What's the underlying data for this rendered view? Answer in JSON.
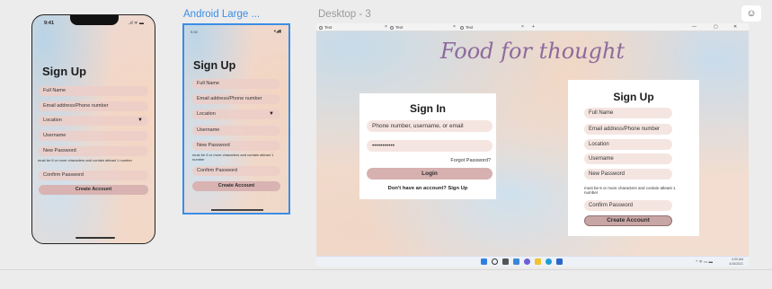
{
  "canvas": {
    "corner_icon": "comment-icon"
  },
  "iphone": {
    "time": "9:41",
    "status": "..ıl ᯤ ▬",
    "title": "Sign Up",
    "fields": {
      "full_name": "Full Name",
      "email": "Email address/Phone number",
      "location": "Location",
      "location_caret": "▼",
      "username": "Username",
      "password": "New Password",
      "confirm": "Confirm Password"
    },
    "hint": "must be 6 or more characters and contain atleast 1 number",
    "button": "Create Account"
  },
  "android": {
    "frame_label": "Android Large ...",
    "time": "9:30",
    "status": "▾◢▮",
    "title": "Sign Up",
    "fields": {
      "full_name": "Full Name",
      "email": "Email address/Phone number",
      "location": "Location",
      "location_caret": "▼",
      "username": "Username",
      "password": "New Password",
      "confirm": "Confirm Password"
    },
    "hint": "must be 6 or more characters and contain atleast 1 number",
    "button": "Create Account"
  },
  "desktop": {
    "frame_label": "Desktop - 3",
    "tabs": [
      "Text",
      "Text",
      "Text"
    ],
    "tab_close": "×",
    "tab_add": "+",
    "window_controls": [
      "—",
      "▢",
      "✕"
    ],
    "headline": "Food for thought",
    "signin": {
      "title": "Sign In",
      "username_placeholder": "Phone number, username, or email",
      "password_value": "•••••••••••",
      "forgot": "Forgot Password?",
      "button": "Login",
      "footer": "Don't have an account? Sign Up"
    },
    "signup": {
      "title": "Sign Up",
      "full_name": "Full Name",
      "email": "Email address/Phone number",
      "location": "Location",
      "username": "Username",
      "password": "New Password",
      "hint": "must be 6 or more characters and contain atleast 1 number",
      "confirm": "Confirm Password",
      "button": "Create Account"
    },
    "taskbar": {
      "tray": "^ ᯤ ▭ ▬",
      "clock_time": "4:00 AM",
      "clock_date": "4/15/2021",
      "icons": [
        "windows-icon",
        "search-icon",
        "file-explorer-icon",
        "widgets-icon",
        "chat-icon",
        "folder-icon",
        "edge-icon",
        "store-icon"
      ]
    }
  },
  "colors": {
    "accent_blue": "#3b8de6",
    "field_pink": "#f5e5e1",
    "button_rose": "#d6b1b0",
    "headline_purple": "#8e6a9c"
  }
}
